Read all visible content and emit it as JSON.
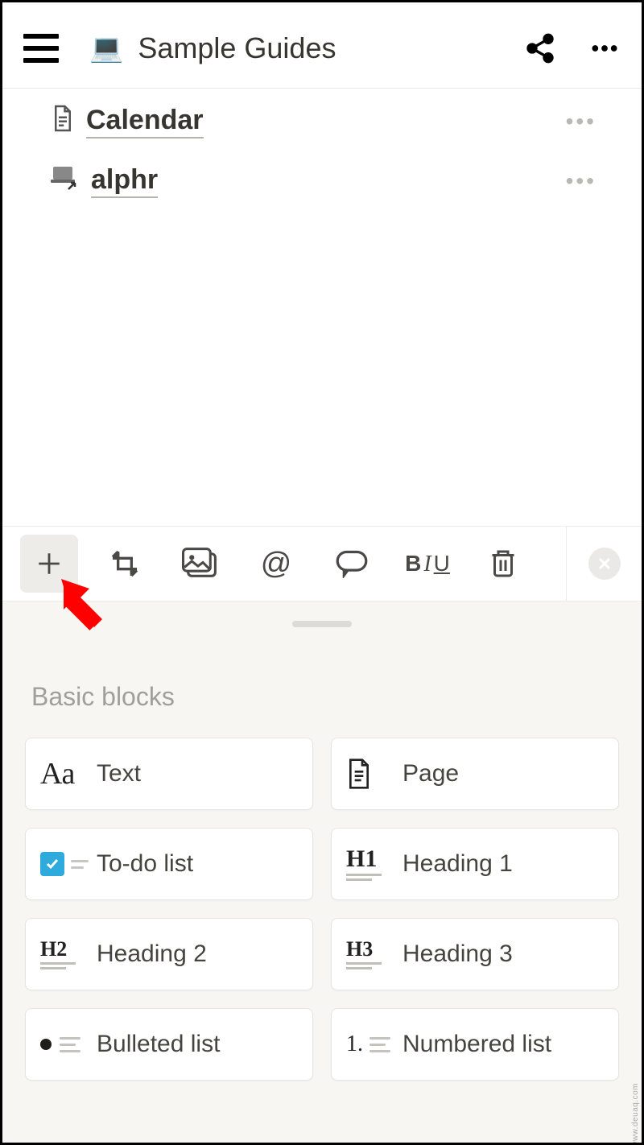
{
  "header": {
    "title": "Sample Guides",
    "page_emoji": "💻"
  },
  "items": [
    {
      "icon": "📄",
      "label": "Calendar"
    },
    {
      "icon": "💻",
      "label": "alphr"
    }
  ],
  "toolbar": {
    "plus": "plus-icon",
    "move": "move-block-icon",
    "image": "image-icon",
    "mention": "@",
    "comment": "comment-icon",
    "format_b": "B",
    "format_i": "I",
    "format_u": "U",
    "trash": "trash-icon",
    "close": "close-icon"
  },
  "sheet": {
    "section": "Basic blocks",
    "blocks": [
      {
        "label": "Text",
        "icon": "Aa"
      },
      {
        "label": "Page",
        "icon": "page"
      },
      {
        "label": "To-do list",
        "icon": "todo"
      },
      {
        "label": "Heading 1",
        "icon": "H1"
      },
      {
        "label": "Heading 2",
        "icon": "H2"
      },
      {
        "label": "Heading 3",
        "icon": "H3"
      },
      {
        "label": "Bulleted list",
        "icon": "bullet"
      },
      {
        "label": "Numbered list",
        "icon": "number"
      }
    ]
  },
  "watermark": "www.deuaq.com"
}
